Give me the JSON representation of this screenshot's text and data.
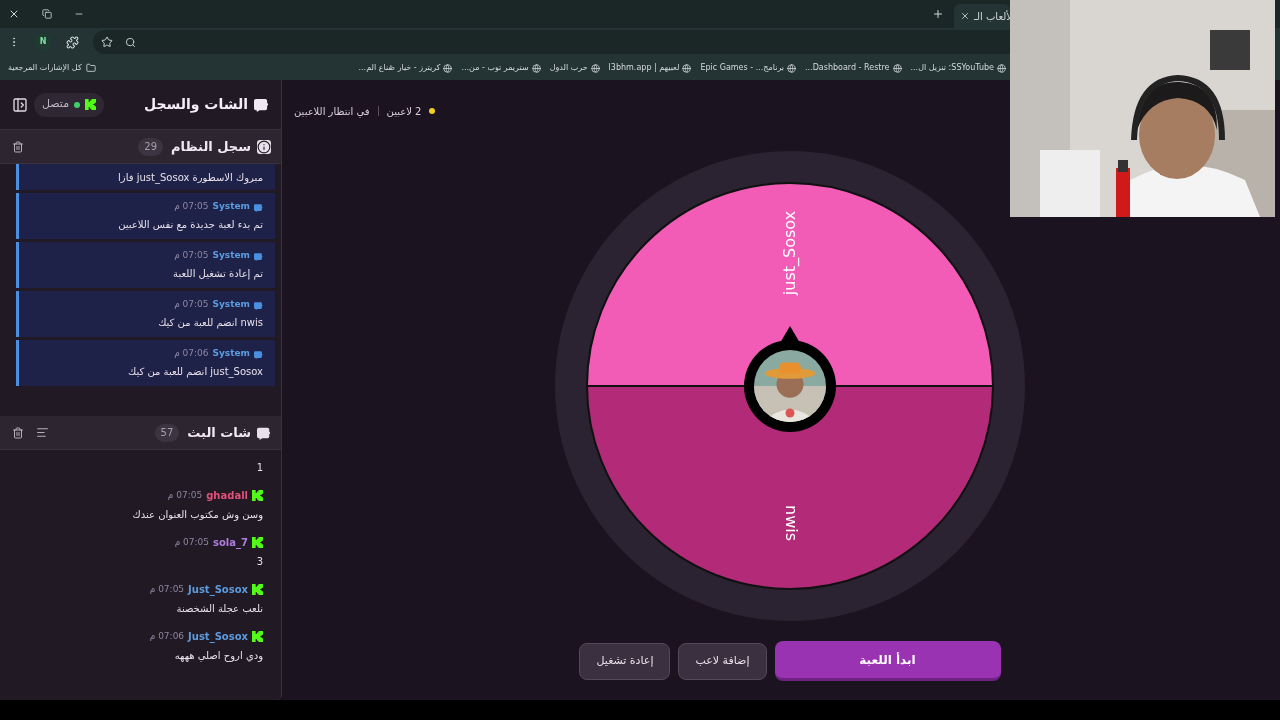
{
  "browser": {
    "tab": {
      "title": "لألعاب الـ"
    },
    "profile_initial": "N",
    "bookmarks": [
      "SSYouTube: تنزيل ال...",
      "Dashboard - Restre...",
      "برنامج... - Epic Games",
      "لعبيهم | l3bhm.app",
      "حرب الدول",
      "ستريمر توب - من...",
      "كريترز - خيار صُناع الم..."
    ],
    "all_bookmarks": "كل الإشارات المرجعية"
  },
  "chat_panel": {
    "title": "الشات والسجل",
    "connection": {
      "label": "متصل",
      "connected": true
    },
    "system_log": {
      "title": "سجل النظام",
      "count": "29",
      "messages": [
        {
          "text": "مبروك الاسطورة just_Sosox فازا"
        },
        {
          "sender": "System",
          "time": "07:05 م",
          "text": "تم بدء لعبة جديدة مع نفس اللاعبين"
        },
        {
          "sender": "System",
          "time": "07:05 م",
          "text": "تم إعادة تشغيل اللعبة"
        },
        {
          "sender": "System",
          "time": "07:05 م",
          "text": "nwis انضم للعبة من كيك"
        },
        {
          "sender": "System",
          "time": "07:06 م",
          "text": "just_Sosox انضم للعبة من كيك"
        }
      ]
    },
    "stream_chat": {
      "title": "شات البث",
      "count": "57",
      "messages": [
        {
          "text": "1"
        },
        {
          "sender": "ghadall",
          "color": "#e0507a",
          "time": "07:05 م",
          "text": "وسن وش مكتوب العنوان عندك"
        },
        {
          "sender": "sola_7",
          "color": "#b07ce0",
          "time": "07:05 م",
          "text": "3"
        },
        {
          "sender": "Just_Sosox",
          "color": "#5b9be0",
          "time": "07:05 م",
          "text": "نلعب عجلة الشخصنة"
        },
        {
          "sender": "Just_Sosox",
          "color": "#5b9be0",
          "time": "07:06 م",
          "text": "ودي اروح اصلي هههه"
        }
      ]
    }
  },
  "status": {
    "players": "2 لاعبين",
    "state": "في انتظار اللاعبين"
  },
  "wheel": {
    "segments": [
      {
        "label": "just_Sosox",
        "color": "#f25cb6"
      },
      {
        "label": "nwis",
        "color": "#b22a78"
      }
    ]
  },
  "buttons": [
    {
      "label": "ابدأ اللعبة",
      "kind": "primary"
    },
    {
      "label": "إضافة لاعب",
      "kind": "secondary"
    },
    {
      "label": "إعادة تشغيل",
      "kind": "secondary"
    }
  ]
}
